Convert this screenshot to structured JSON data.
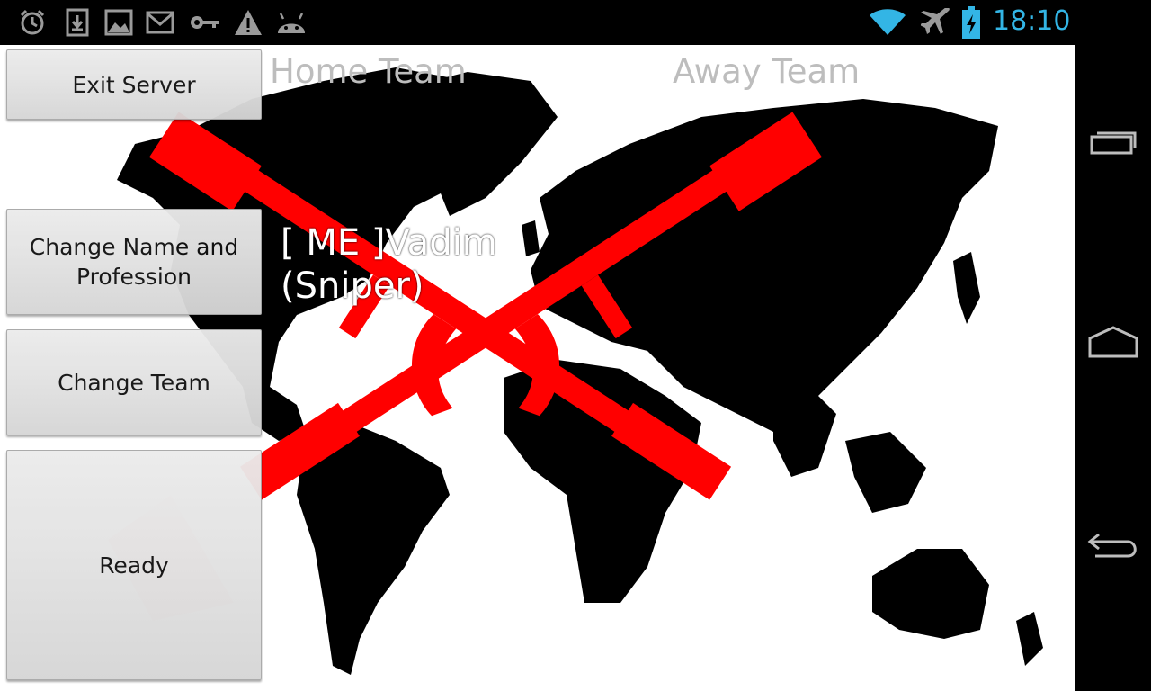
{
  "status_bar": {
    "time": "18:10",
    "accent_color": "#33b5e5",
    "left_icons": [
      "alarm-icon",
      "download-icon",
      "image-icon",
      "gmail-icon",
      "key-icon",
      "warning-icon",
      "android-icon"
    ],
    "right_icons": [
      "wifi-icon",
      "airplane-icon",
      "battery-charging-icon"
    ]
  },
  "teams": {
    "home_label": "Home Team",
    "away_label": "Away Team"
  },
  "player": {
    "name_line": "[ ME ]Vadim",
    "profession_line": "(Sniper)"
  },
  "buttons": {
    "exit_server": "Exit Server",
    "change_name_profession": "Change Name and Profession",
    "change_team": "Change Team",
    "ready": "Ready"
  },
  "nav_bar": {
    "buttons": [
      "recent-apps-icon",
      "home-icon",
      "back-icon"
    ]
  }
}
